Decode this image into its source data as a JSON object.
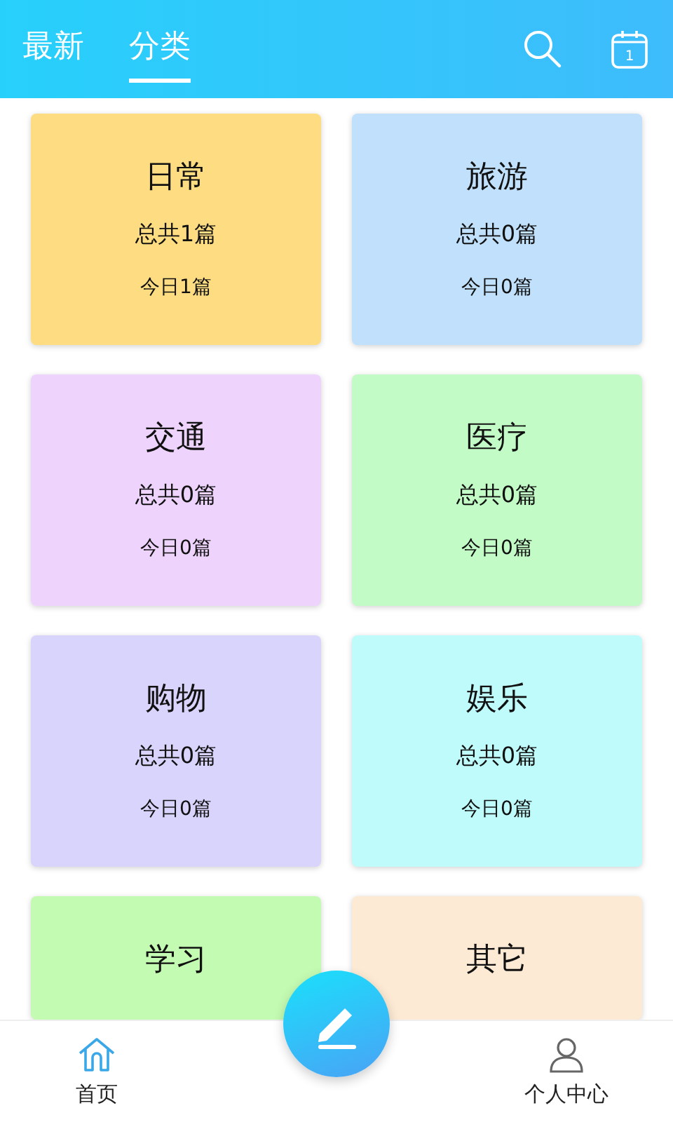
{
  "tabs": [
    {
      "label": "最新",
      "selected": false
    },
    {
      "label": "分类",
      "selected": true
    }
  ],
  "calendar_day": "1",
  "categories": [
    {
      "name": "日常",
      "total": "总共1篇",
      "today": "今日1篇",
      "color": "#fddc82"
    },
    {
      "name": "旅游",
      "total": "总共0篇",
      "today": "今日0篇",
      "color": "#c0e0fb"
    },
    {
      "name": "交通",
      "total": "总共0篇",
      "today": "今日0篇",
      "color": "#eed4fd"
    },
    {
      "name": "医疗",
      "total": "总共0篇",
      "today": "今日0篇",
      "color": "#c2fbc6"
    },
    {
      "name": "购物",
      "total": "总共0篇",
      "today": "今日0篇",
      "color": "#d8d4fb"
    },
    {
      "name": "娱乐",
      "total": "总共0篇",
      "today": "今日0篇",
      "color": "#c0fbfb"
    },
    {
      "name": "学习",
      "color": "#c4fbb2"
    },
    {
      "name": "其它",
      "color": "#fdead4"
    }
  ],
  "nav": [
    {
      "label": "首页",
      "kind": "home",
      "selected": true
    },
    {
      "label": "个人中心",
      "kind": "profile",
      "selected": false
    }
  ]
}
